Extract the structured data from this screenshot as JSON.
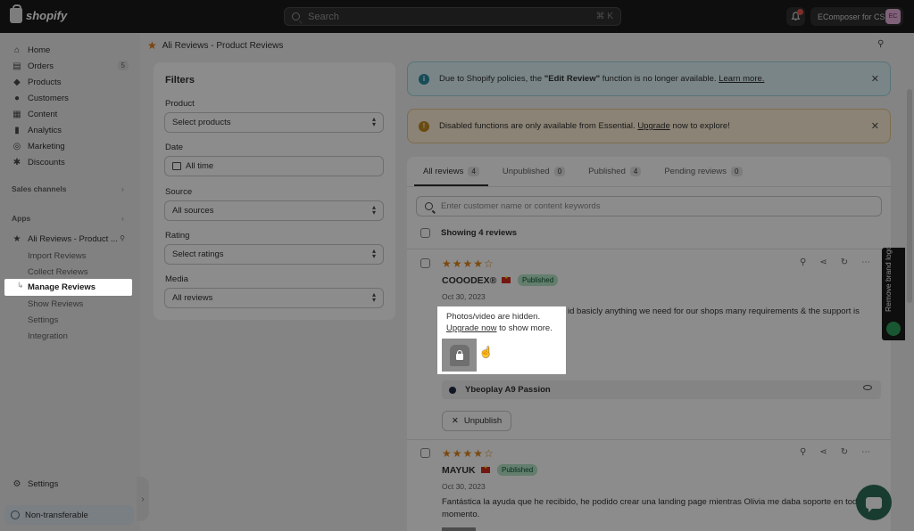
{
  "topbar": {
    "brand": "shopify",
    "search_placeholder": "Search",
    "search_shortcut": "⌘ K",
    "store_name": "EComposer for CS",
    "store_initials": "EC"
  },
  "sidebar": {
    "items": [
      {
        "label": "Home",
        "icon": "home-icon"
      },
      {
        "label": "Orders",
        "icon": "orders-icon",
        "count": "5"
      },
      {
        "label": "Products",
        "icon": "tag-icon"
      },
      {
        "label": "Customers",
        "icon": "person-icon"
      },
      {
        "label": "Content",
        "icon": "content-icon"
      },
      {
        "label": "Analytics",
        "icon": "chart-icon"
      },
      {
        "label": "Marketing",
        "icon": "target-icon"
      },
      {
        "label": "Discounts",
        "icon": "discount-icon"
      }
    ],
    "sales_channels": "Sales channels",
    "apps": "Apps",
    "app_name": "Ali Reviews - Product ...",
    "app_subitems": [
      "Import Reviews",
      "Collect Reviews",
      "Manage Reviews",
      "Show Reviews",
      "Settings",
      "Integration"
    ],
    "settings": "Settings",
    "non_transferable": "Non-transferable"
  },
  "header": {
    "breadcrumb": "Ali Reviews - Product Reviews"
  },
  "filters": {
    "title": "Filters",
    "product_label": "Product",
    "product_value": "Select products",
    "date_label": "Date",
    "date_value": "All time",
    "source_label": "Source",
    "source_value": "All sources",
    "rating_label": "Rating",
    "rating_value": "Select ratings",
    "media_label": "Media",
    "media_value": "All reviews"
  },
  "banners": {
    "info_pre": "Due to Shopify policies, the ",
    "info_bold": "\"Edit Review\"",
    "info_post": " function is no longer available. ",
    "info_link": "Learn more.",
    "warn_pre": "Disabled functions are only available from Essential. ",
    "warn_link": "Upgrade",
    "warn_post": " now to explore!"
  },
  "tabs": [
    {
      "label": "All reviews",
      "count": "4"
    },
    {
      "label": "Unpublished",
      "count": "0"
    },
    {
      "label": "Published",
      "count": "4"
    },
    {
      "label": "Pending reviews",
      "count": "0"
    }
  ],
  "review_search_placeholder": "Enter customer name or content keywords",
  "showing": "Showing 4 reviews",
  "reviews": [
    {
      "stars": "★★★★☆",
      "rating": 4,
      "name": "COOODEX®",
      "status": "Published",
      "date": "Oct 30, 2023",
      "text": "id basicly anything we need for our shops many requirements & the support is",
      "product": "Ybeoplay A9 Passion",
      "unpublish": "Unpublish"
    },
    {
      "stars": "★★★★☆",
      "rating": 4,
      "name": "MAYUK",
      "status": "Published",
      "date": "Oct 30, 2023",
      "text": "Fantástica la ayuda que he recibido, he podido crear una landing page mientras Olivia me daba soporte en todo momento."
    }
  ],
  "popup": {
    "line1": "Photos/video are hidden.",
    "link": "Upgrade now",
    "line2_post": " to show more."
  },
  "side_tab": "Remove brand logo",
  "colors": {
    "accent_star": "#e0851b",
    "published_bg": "#b4e6c6",
    "topbar": "#1a1a1a"
  }
}
